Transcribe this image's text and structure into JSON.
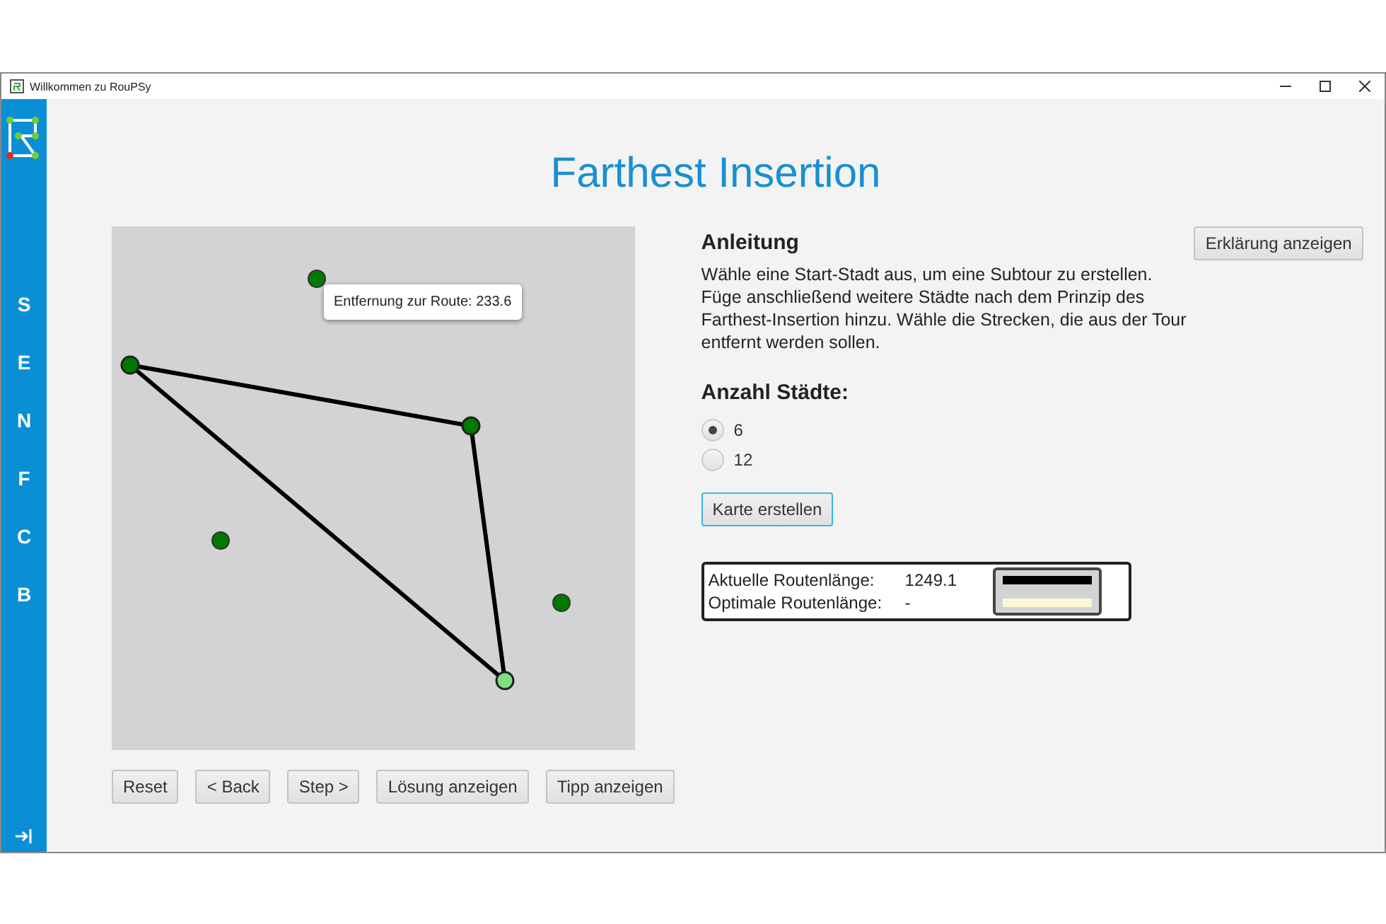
{
  "window": {
    "title": "Willkommen zu RouPSy"
  },
  "sidebar": {
    "items": [
      {
        "label": "S"
      },
      {
        "label": "E"
      },
      {
        "label": "N"
      },
      {
        "label": "F"
      },
      {
        "label": "C"
      },
      {
        "label": "B"
      }
    ]
  },
  "heading": "Farthest Insertion",
  "map": {
    "cities": [
      {
        "in_route": false,
        "selected": false
      },
      {
        "in_route": true,
        "selected": false
      },
      {
        "in_route": true,
        "selected": false
      },
      {
        "in_route": false,
        "selected": false
      },
      {
        "in_route": false,
        "selected": false
      },
      {
        "in_route": true,
        "selected": true
      }
    ],
    "tooltip": "Entfernung zur Route: 233.6"
  },
  "controls": [
    "Reset",
    "< Back",
    "Step >",
    "Lösung anzeigen",
    "Tipp anzeigen"
  ],
  "instructions": {
    "title": "Anleitung",
    "text": "Wähle eine Start-Stadt aus, um eine Subtour zu erstellen. Füge anschließend weitere Städte nach dem Prinzip des Farthest-Insertion hinzu. Wähle die Strecken, die aus der Tour entfernt werden sollen.",
    "button": "Erklärung anzeigen"
  },
  "city_count": {
    "label": "Anzahl Städte:",
    "options": [
      {
        "label": "6",
        "selected": true
      },
      {
        "label": "12",
        "selected": false
      }
    ],
    "button": "Karte erstellen"
  },
  "legend": [
    {
      "label": "Aktuelle Routenlänge:",
      "value": "1249.1",
      "color": "#000000"
    },
    {
      "label": "Optimale Routenlänge:",
      "value": "-",
      "color": "#fafad2"
    }
  ]
}
